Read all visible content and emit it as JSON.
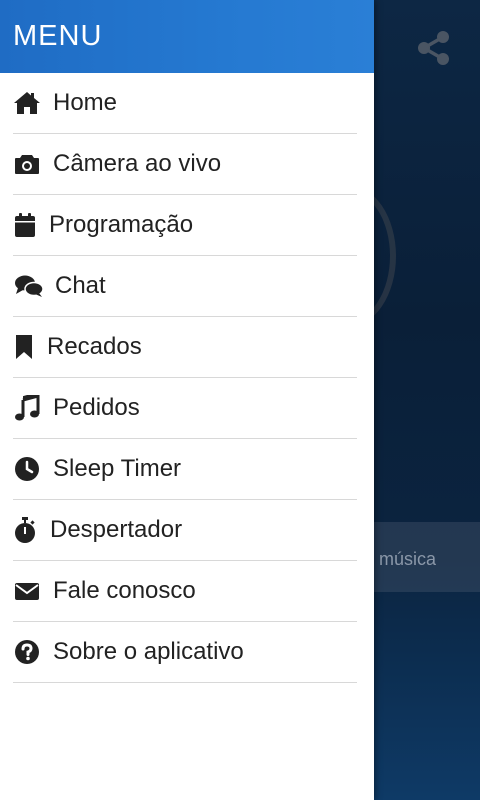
{
  "background": {
    "song_text": "a música",
    "share_icon": "share-icon"
  },
  "drawer": {
    "title": "MENU",
    "items": [
      {
        "label": "Home",
        "icon": "home-icon"
      },
      {
        "label": "Câmera ao vivo",
        "icon": "camera-icon"
      },
      {
        "label": "Programação",
        "icon": "calendar-icon"
      },
      {
        "label": "Chat",
        "icon": "chat-icon"
      },
      {
        "label": "Recados",
        "icon": "bookmark-icon"
      },
      {
        "label": "Pedidos",
        "icon": "music-icon"
      },
      {
        "label": "Sleep Timer",
        "icon": "clock-icon"
      },
      {
        "label": "Despertador",
        "icon": "stopwatch-icon"
      },
      {
        "label": "Fale conosco",
        "icon": "envelope-icon"
      },
      {
        "label": "Sobre o aplicativo",
        "icon": "question-icon"
      }
    ]
  },
  "colors": {
    "header_blue": "#1f6cc4",
    "icon_dark": "#222222"
  }
}
